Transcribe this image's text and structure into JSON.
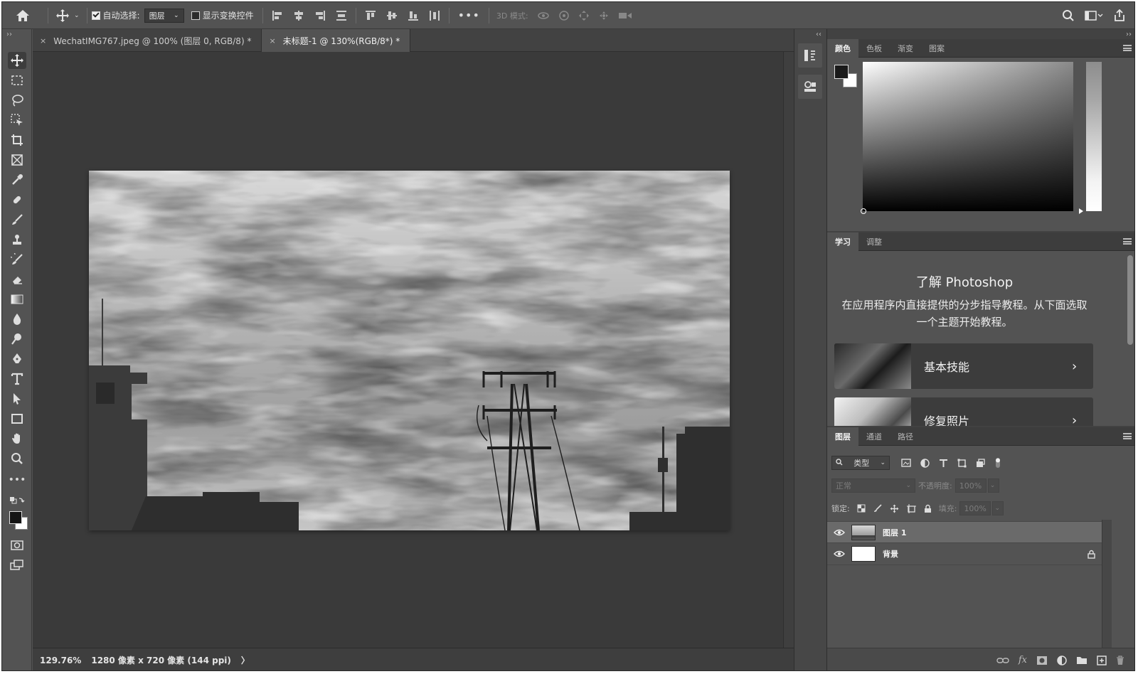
{
  "options_bar": {
    "auto_select_label": "自动选择:",
    "auto_select_value": "图层",
    "show_transform_label": "显示变换控件",
    "mode_3d_label": "3D 模式:"
  },
  "tabs": [
    {
      "label": "WechatIMG767.jpeg @ 100% (图层 0, RGB/8) *",
      "close": "×"
    },
    {
      "label": "未标题-1 @ 130%(RGB/8*) *",
      "close": "×"
    }
  ],
  "status_bar": {
    "zoom": "129.76%",
    "doc_info": "1280 像素 x 720 像素 (144 ppi)",
    "arrow": "〉"
  },
  "color_panel": {
    "tabs": [
      "颜色",
      "色板",
      "渐变",
      "图案"
    ],
    "foreground": "#1a1a1a",
    "background": "#ffffff"
  },
  "learn_panel": {
    "tabs": [
      "学习",
      "调整"
    ],
    "title": "了解 Photoshop",
    "description": "在应用程序内直接提供的分步指导教程。从下面选取一个主题开始教程。",
    "cards": [
      {
        "label": "基本技能",
        "chevron": "›"
      },
      {
        "label": "修复照片",
        "chevron": "›"
      }
    ]
  },
  "layers_panel": {
    "tabs": [
      "图层",
      "通道",
      "路径"
    ],
    "filter_label": "类型",
    "blend_mode": "正常",
    "opacity_label": "不透明度:",
    "opacity_value": "100%",
    "lock_label": "锁定:",
    "fill_label": "填充:",
    "fill_value": "100%",
    "layers": [
      {
        "name": "图层 1",
        "visible": true,
        "selected": true,
        "locked": false
      },
      {
        "name": "背景",
        "visible": true,
        "selected": false,
        "locked": true
      }
    ]
  },
  "tools": [
    "move-tool-icon",
    "marquee-tool-icon",
    "lasso-tool-icon",
    "object-select-tool-icon",
    "crop-tool-icon",
    "frame-tool-icon",
    "eyedropper-tool-icon",
    "healing-brush-icon",
    "brush-tool-icon",
    "clone-stamp-icon",
    "history-brush-icon",
    "eraser-tool-icon",
    "gradient-tool-icon",
    "blur-tool-icon",
    "dodge-tool-icon",
    "pen-tool-icon",
    "type-tool-icon",
    "path-select-icon",
    "rectangle-tool-icon",
    "hand-tool-icon",
    "zoom-tool-icon",
    "more-tools-icon"
  ]
}
